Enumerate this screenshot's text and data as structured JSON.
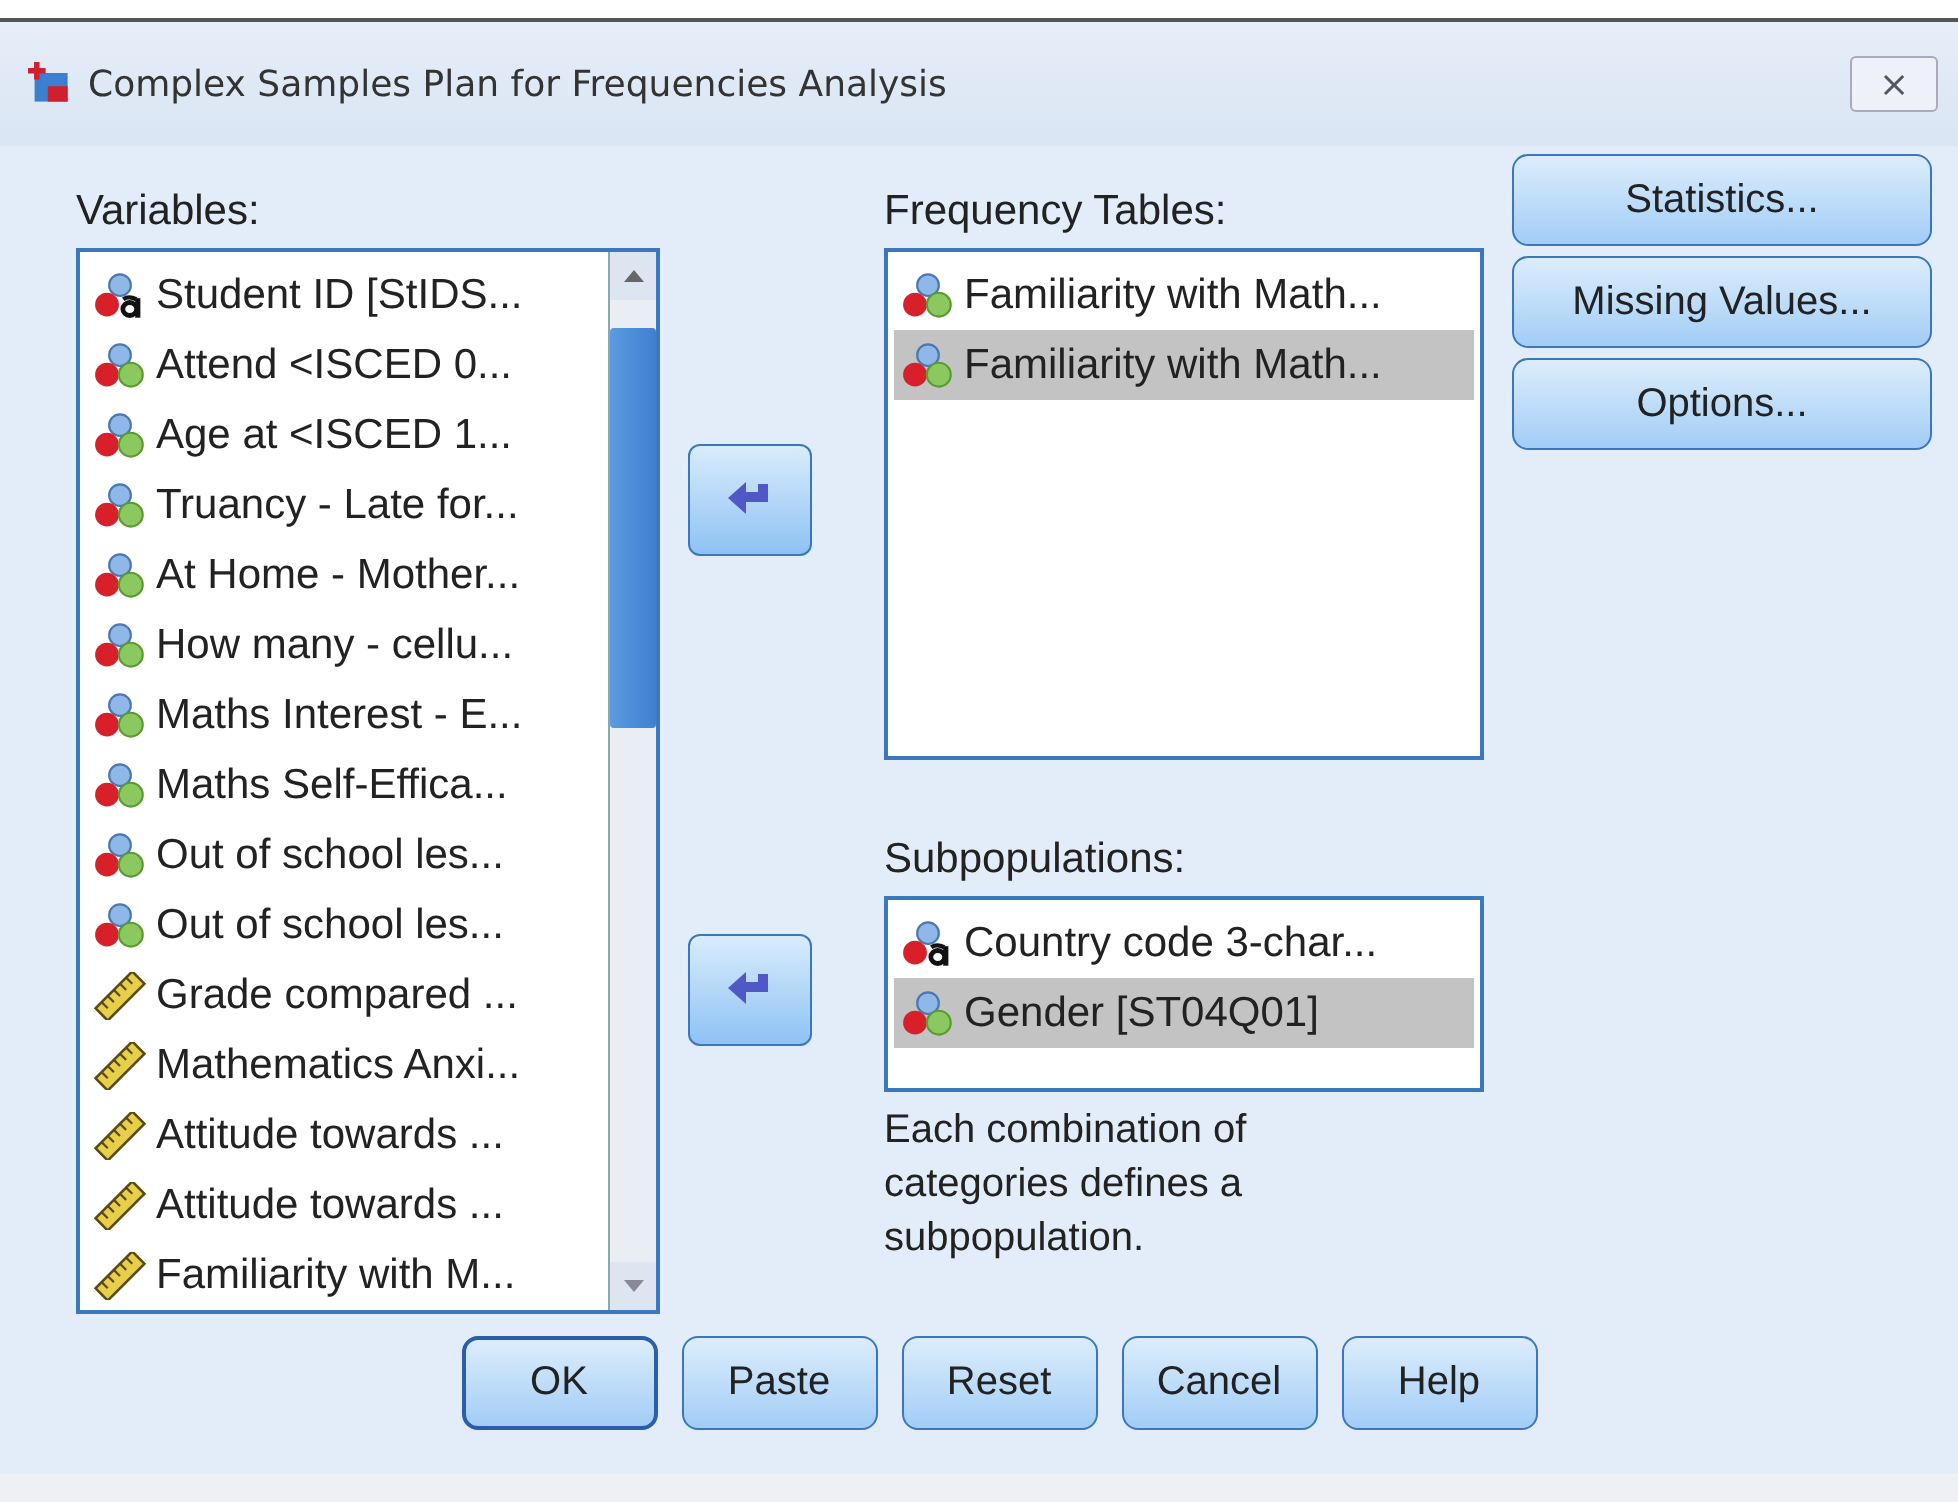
{
  "window": {
    "title": "Complex Samples Plan for Frequencies Analysis",
    "close": "⨯"
  },
  "variables": {
    "label": "Variables:",
    "items": [
      {
        "text": "Student ID [StIDS...",
        "kind": "nominal-string",
        "selected": false
      },
      {
        "text": "Attend <ISCED 0...",
        "kind": "nominal",
        "selected": false
      },
      {
        "text": "Age at <ISCED 1...",
        "kind": "nominal",
        "selected": false
      },
      {
        "text": "Truancy - Late for...",
        "kind": "nominal",
        "selected": false
      },
      {
        "text": "At Home - Mother...",
        "kind": "nominal",
        "selected": false
      },
      {
        "text": "How many - cellu...",
        "kind": "nominal",
        "selected": false
      },
      {
        "text": "Maths Interest - E...",
        "kind": "nominal",
        "selected": false
      },
      {
        "text": "Maths Self-Effica...",
        "kind": "nominal",
        "selected": false
      },
      {
        "text": "Out of school les...",
        "kind": "nominal",
        "selected": false
      },
      {
        "text": "Out of school les...",
        "kind": "nominal",
        "selected": false
      },
      {
        "text": "Grade compared ...",
        "kind": "scale",
        "selected": false
      },
      {
        "text": "Mathematics Anxi...",
        "kind": "scale",
        "selected": false
      },
      {
        "text": "Attitude towards ...",
        "kind": "scale",
        "selected": false
      },
      {
        "text": "Attitude towards ...",
        "kind": "scale",
        "selected": false
      },
      {
        "text": "Familiarity with M...",
        "kind": "scale",
        "selected": false
      }
    ]
  },
  "frequency_tables": {
    "label": "Frequency Tables:",
    "items": [
      {
        "text": "Familiarity with Math...",
        "kind": "nominal",
        "selected": false
      },
      {
        "text": "Familiarity with Math...",
        "kind": "nominal",
        "selected": true
      }
    ]
  },
  "subpopulations": {
    "label": "Subpopulations:",
    "items": [
      {
        "text": "Country code 3-char...",
        "kind": "nominal-string",
        "selected": false
      },
      {
        "text": "Gender [ST04Q01]",
        "kind": "nominal",
        "selected": true
      }
    ],
    "note": "Each combination of categories defines a subpopulation."
  },
  "side_buttons": [
    "Statistics...",
    "Missing Values...",
    "Options..."
  ],
  "bottom_buttons": [
    {
      "label": "OK",
      "default": true
    },
    {
      "label": "Paste",
      "default": false
    },
    {
      "label": "Reset",
      "default": false
    },
    {
      "label": "Cancel",
      "default": false
    },
    {
      "label": "Help",
      "default": false
    }
  ]
}
